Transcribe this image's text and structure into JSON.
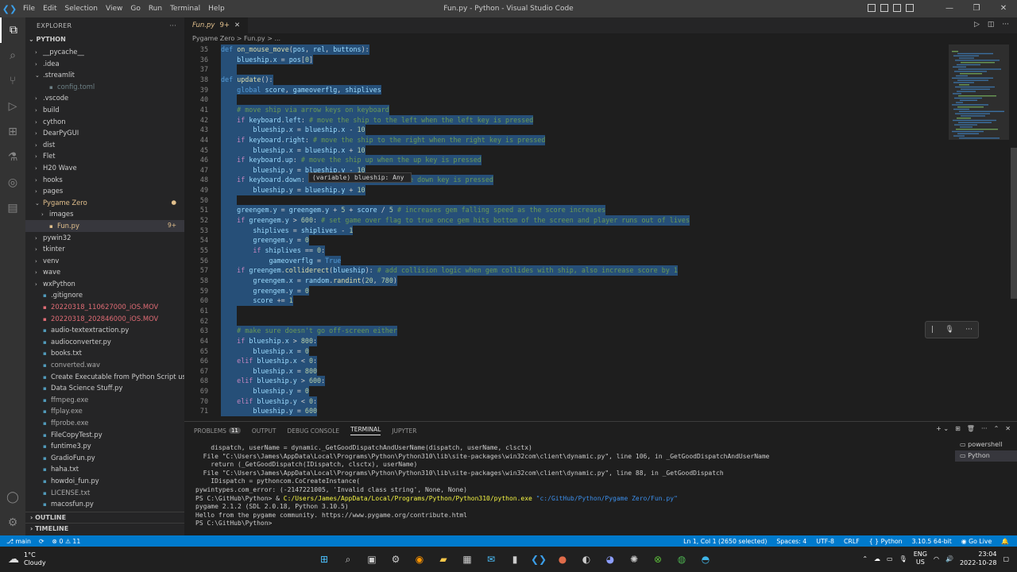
{
  "titlebar": {
    "menu": [
      "File",
      "Edit",
      "Selection",
      "View",
      "Go",
      "Run",
      "Terminal",
      "Help"
    ],
    "title": "Fun.py - Python - Visual Studio Code",
    "minimize": "—",
    "restore": "❐",
    "close": "✕"
  },
  "sidebar": {
    "header": "EXPLORER",
    "more": "···",
    "folder": "PYTHON",
    "items": [
      {
        "label": "__pycache__",
        "type": "folder",
        "depth": 1,
        "open": false
      },
      {
        "label": ".idea",
        "type": "folder",
        "depth": 1,
        "open": false
      },
      {
        "label": ".streamlit",
        "type": "folder",
        "depth": 1,
        "open": true
      },
      {
        "label": "config.toml",
        "type": "file",
        "depth": 2,
        "color": "#6d8086"
      },
      {
        "label": ".vscode",
        "type": "folder",
        "depth": 1,
        "open": false
      },
      {
        "label": "build",
        "type": "folder",
        "depth": 1,
        "open": false
      },
      {
        "label": "cython",
        "type": "folder",
        "depth": 1,
        "open": false
      },
      {
        "label": "DearPyGUI",
        "type": "folder",
        "depth": 1,
        "open": false
      },
      {
        "label": "dist",
        "type": "folder",
        "depth": 1,
        "open": false
      },
      {
        "label": "Flet",
        "type": "folder",
        "depth": 1,
        "open": false
      },
      {
        "label": "H20 Wave",
        "type": "folder",
        "depth": 1,
        "open": false
      },
      {
        "label": "hooks",
        "type": "folder",
        "depth": 1,
        "open": false
      },
      {
        "label": "pages",
        "type": "folder",
        "depth": 1,
        "open": false
      },
      {
        "label": "Pygame Zero",
        "type": "folder",
        "depth": 1,
        "open": true,
        "color": "#e2c08d",
        "badge": "●"
      },
      {
        "label": "images",
        "type": "folder",
        "depth": 2,
        "open": false
      },
      {
        "label": "Fun.py",
        "type": "file",
        "depth": 2,
        "color": "#e2c08d",
        "badge": "9+",
        "selected": true
      },
      {
        "label": "pywin32",
        "type": "folder",
        "depth": 1,
        "open": false
      },
      {
        "label": "tkinter",
        "type": "folder",
        "depth": 1,
        "open": false
      },
      {
        "label": "venv",
        "type": "folder",
        "depth": 1,
        "open": false
      },
      {
        "label": "wave",
        "type": "folder",
        "depth": 1,
        "open": false
      },
      {
        "label": "wxPython",
        "type": "folder",
        "depth": 1,
        "open": false
      },
      {
        "label": ".gitignore",
        "type": "file",
        "depth": 1
      },
      {
        "label": "20220318_110627000_iOS.MOV",
        "type": "file",
        "depth": 1,
        "color": "#e06c75"
      },
      {
        "label": "20220318_202846000_iOS.MOV",
        "type": "file",
        "depth": 1,
        "color": "#e06c75"
      },
      {
        "label": "audio-textextraction.py",
        "type": "file",
        "depth": 1
      },
      {
        "label": "audioconverter.py",
        "type": "file",
        "depth": 1
      },
      {
        "label": "books.txt",
        "type": "file",
        "depth": 1
      },
      {
        "label": "converted.wav",
        "type": "file",
        "depth": 1,
        "color": "#a9a9a9"
      },
      {
        "label": "Create Executable from Python Script using ...",
        "type": "file",
        "depth": 1
      },
      {
        "label": "Data Science Stuff.py",
        "type": "file",
        "depth": 1
      },
      {
        "label": "ffmpeg.exe",
        "type": "file",
        "depth": 1,
        "color": "#a9a9a9"
      },
      {
        "label": "ffplay.exe",
        "type": "file",
        "depth": 1,
        "color": "#a9a9a9"
      },
      {
        "label": "ffprobe.exe",
        "type": "file",
        "depth": 1,
        "color": "#a9a9a9"
      },
      {
        "label": "FileCopyTest.py",
        "type": "file",
        "depth": 1
      },
      {
        "label": "funtime3.py",
        "type": "file",
        "depth": 1
      },
      {
        "label": "GradioFun.py",
        "type": "file",
        "depth": 1
      },
      {
        "label": "haha.txt",
        "type": "file",
        "depth": 1
      },
      {
        "label": "howdoi_fun.py",
        "type": "file",
        "depth": 1
      },
      {
        "label": "LICENSE.txt",
        "type": "file",
        "depth": 1,
        "color": "#a9a9a9"
      },
      {
        "label": "macosfun.py",
        "type": "file",
        "depth": 1
      }
    ],
    "outline": "OUTLINE",
    "timeline": "TIMELINE"
  },
  "editor": {
    "tab": {
      "label": "Fun.py",
      "badge": "9+"
    },
    "breadcrumb": "Pygame Zero  >  Fun.py  >  ...",
    "hover": "(variable) blueship: Any",
    "lines": [
      {
        "n": "35",
        "html": "<span class=\"kw2\">def</span> <span class=\"fn\">on_mouse_move</span>(<span class=\"var\">pos</span>, <span class=\"var\">rel</span>, <span class=\"var\">buttons</span>):"
      },
      {
        "n": "36",
        "html": "    <span class=\"var\">blueship</span>.<span class=\"var\">x</span> = <span class=\"var\">pos</span>[<span class=\"num\">0</span>]"
      },
      {
        "n": "37",
        "html": ""
      },
      {
        "n": "38",
        "html": "<span class=\"kw2\">def</span> <span class=\"fn\">update</span>():"
      },
      {
        "n": "39",
        "html": "    <span class=\"kw2\">global</span> <span class=\"var\">score</span>, <span class=\"var\">gameoverflg</span>, <span class=\"var\">shiplives</span>"
      },
      {
        "n": "40",
        "html": ""
      },
      {
        "n": "41",
        "html": "    <span class=\"cm\"># move ship via arrow keys on keyboard</span>"
      },
      {
        "n": "42",
        "html": "    <span class=\"kw\">if</span> <span class=\"var\">keyboard</span>.<span class=\"var\">left</span>: <span class=\"cm\"># move the ship to the left when the left key is pressed</span>"
      },
      {
        "n": "43",
        "html": "        <span class=\"var\">blueship</span>.<span class=\"var\">x</span> = <span class=\"var\">blueship</span>.<span class=\"var\">x</span> - <span class=\"num\">10</span>"
      },
      {
        "n": "44",
        "html": "    <span class=\"kw\">if</span> <span class=\"var\">keyboard</span>.<span class=\"var\">right</span>: <span class=\"cm\"># move the ship to the right when the right key is pressed</span>"
      },
      {
        "n": "45",
        "html": "        <span class=\"var\">blueship</span>.<span class=\"var\">x</span> = <span class=\"var\">blueship</span>.<span class=\"var\">x</span> + <span class=\"num\">10</span>"
      },
      {
        "n": "46",
        "html": "    <span class=\"kw\">if</span> <span class=\"var\">keyboard</span>.<span class=\"var\">up</span>: <span class=\"cm\"># move the ship up when the up key is pressed</span>"
      },
      {
        "n": "47",
        "html": "        <span class=\"var\">blueship</span>.<span class=\"var\">y</span> = <span class=\"var\">blueship</span>.<span class=\"var\">y</span> - <span class=\"num\">10</span>"
      },
      {
        "n": "48",
        "html": "    <span class=\"kw\">if</span> <span class=\"var\">keyboard</span>.<span class=\"var\">down</span>:                        <span class=\"cm\">the down key is pressed</span>"
      },
      {
        "n": "49",
        "html": "        <span class=\"var\">blueship</span>.<span class=\"var\">y</span> = <span class=\"var\">blueship</span>.<span class=\"var\">y</span> + <span class=\"num\">10</span>"
      },
      {
        "n": "50",
        "html": ""
      },
      {
        "n": "51",
        "html": "    <span class=\"var\">greengem</span>.<span class=\"var\">y</span> = <span class=\"var\">greengem</span>.<span class=\"var\">y</span> + <span class=\"num\">5</span> + <span class=\"var\">score</span> / <span class=\"num\">5</span> <span class=\"cm\"># increases gem falling speed as the score increases</span>"
      },
      {
        "n": "52",
        "html": "    <span class=\"kw\">if</span> <span class=\"var\">greengem</span>.<span class=\"var\">y</span> > <span class=\"num\">600</span>: <span class=\"cm\"># set game over flag to true once gem hits bottom of the screen and player runs out of lives</span>"
      },
      {
        "n": "53",
        "html": "        <span class=\"var\">shiplives</span> = <span class=\"var\">shiplives</span> - <span class=\"num\">1</span>"
      },
      {
        "n": "54",
        "html": "        <span class=\"var\">greengem</span>.<span class=\"var\">y</span> = <span class=\"num\">0</span>"
      },
      {
        "n": "55",
        "html": "        <span class=\"kw\">if</span> <span class=\"var\">shiplives</span> == <span class=\"num\">0</span>:"
      },
      {
        "n": "56",
        "html": "            <span class=\"var\">gameoverflg</span> = <span class=\"kw2\">True</span>"
      },
      {
        "n": "57",
        "html": "    <span class=\"kw\">if</span> <span class=\"var\">greengem</span>.<span class=\"fn\">colliderect</span>(<span class=\"var\">blueship</span>): <span class=\"cm\"># add collision logic when gem collides with ship, also increase score by 1</span>"
      },
      {
        "n": "58",
        "html": "        <span class=\"var\">greengem</span>.<span class=\"var\">x</span> = <span class=\"var\">random</span>.<span class=\"fn\">randint</span>(<span class=\"num\">20</span>, <span class=\"num\">780</span>)"
      },
      {
        "n": "59",
        "html": "        <span class=\"var\">greengem</span>.<span class=\"var\">y</span> = <span class=\"num\">0</span>"
      },
      {
        "n": "60",
        "html": "        <span class=\"var\">score</span> += <span class=\"num\">1</span>"
      },
      {
        "n": "61",
        "html": ""
      },
      {
        "n": "62",
        "html": ""
      },
      {
        "n": "63",
        "html": "    <span class=\"cm\"># make sure doesn't go off-screen either</span>"
      },
      {
        "n": "64",
        "html": "    <span class=\"kw\">if</span> <span class=\"var\">blueship</span>.<span class=\"var\">x</span> > <span class=\"num\">800</span>:"
      },
      {
        "n": "65",
        "html": "        <span class=\"var\">blueship</span>.<span class=\"var\">x</span> = <span class=\"num\">0</span>"
      },
      {
        "n": "66",
        "html": "    <span class=\"kw\">elif</span> <span class=\"var\">blueship</span>.<span class=\"var\">x</span> < <span class=\"num\">0</span>:"
      },
      {
        "n": "67",
        "html": "        <span class=\"var\">blueship</span>.<span class=\"var\">x</span> = <span class=\"num\">800</span>"
      },
      {
        "n": "68",
        "html": "    <span class=\"kw\">elif</span> <span class=\"var\">blueship</span>.<span class=\"var\">y</span> > <span class=\"num\">600</span>:"
      },
      {
        "n": "69",
        "html": "        <span class=\"var\">blueship</span>.<span class=\"var\">y</span> = <span class=\"num\">0</span>"
      },
      {
        "n": "70",
        "html": "    <span class=\"kw\">elif</span> <span class=\"var\">blueship</span>.<span class=\"var\">y</span> < <span class=\"num\">0</span>:"
      },
      {
        "n": "71",
        "html": "        <span class=\"var\">blueship</span>.<span class=\"var\">y</span> = <span class=\"num\">600</span>"
      }
    ]
  },
  "panel": {
    "tabs": {
      "problems": "PROBLEMS",
      "problems_count": "11",
      "output": "OUTPUT",
      "debug": "DEBUG CONSOLE",
      "terminal": "TERMINAL",
      "jupyter": "JUPYTER"
    },
    "actions": {
      "add": "+ ⌄",
      "split": "⊞",
      "trash": "🗑",
      "more": "···",
      "maximize": "⌃",
      "close": "✕"
    },
    "terminal_lines": [
      {
        "text": "    dispatch, userName = dynamic._GetGoodDispatchAndUserName(dispatch, userName, clsctx)"
      },
      {
        "text": "  File \"C:\\Users\\James\\AppData\\Local\\Programs\\Python\\Python310\\lib\\site-packages\\win32com\\client\\dynamic.py\", line 106, in _GetGoodDispatchAndUserName"
      },
      {
        "text": "    return (_GetGoodDispatch(IDispatch, clsctx), userName)"
      },
      {
        "text": "  File \"C:\\Users\\James\\AppData\\Local\\Programs\\Python\\Python310\\lib\\site-packages\\win32com\\client\\dynamic.py\", line 88, in _GetGoodDispatch"
      },
      {
        "text": "    IDispatch = pythoncom.CoCreateInstance("
      },
      {
        "text": "pywintypes.com_error: (-2147221005, 'Invalid class string', None, None)"
      },
      {
        "prompt": "PS C:\\GitHub\\Python> & ",
        "exe": "C:/Users/James/AppData/Local/Programs/Python/Python310/python.exe",
        "arg": " \"c:/GitHub/Python/Pygame Zero/Fun.py\""
      },
      {
        "text": "pygame 2.1.2 (SDL 2.0.18, Python 3.10.5)"
      },
      {
        "text": "Hello from the pygame community. https://www.pygame.org/contribute.html"
      },
      {
        "text": "PS C:\\GitHub\\Python> "
      }
    ],
    "terminal_list": [
      "powershell",
      "Python"
    ]
  },
  "statusbar": {
    "branch": "⎇ main",
    "sync": "⟳",
    "problems": "⊗ 0 ⚠ 11",
    "position": "Ln 1, Col 1 (2650 selected)",
    "spaces": "Spaces: 4",
    "encoding": "UTF-8",
    "eol": "CRLF",
    "language": "{ } Python",
    "interpreter": "3.10.5 64-bit",
    "golive": "◉ Go Live",
    "bell": "🔔"
  },
  "taskbar": {
    "temp": "1°C",
    "weather": "Cloudy",
    "lang1": "ENG",
    "lang2": "US",
    "time": "23:04",
    "date": "2022-10-28"
  },
  "colors": {
    "accent": "#007acc",
    "selection": "#264f78",
    "modified": "#e2c08d"
  }
}
